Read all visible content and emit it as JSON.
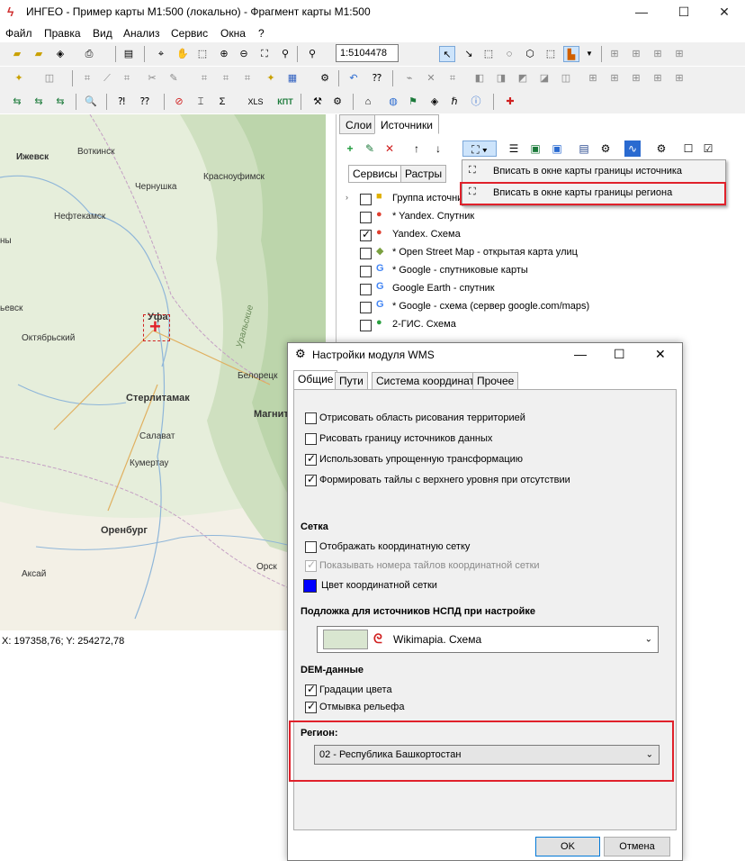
{
  "app": {
    "title": "ИНГЕО - Пример карты М1:500 (локально) - Фрагмент карты М1:500",
    "window_controls": {
      "minimize": "—",
      "maximize": "☐",
      "close": "✕"
    }
  },
  "menu": [
    "Файл",
    "Правка",
    "Вид",
    "Анализ",
    "Сервис",
    "Окна",
    "?"
  ],
  "toolbar": {
    "scale_value": "1:5104478",
    "xls_label": "XLS",
    "kpt_label": "КПТ"
  },
  "map": {
    "cities": [
      {
        "name": "Ижевск",
        "big": false
      },
      {
        "name": "Воткинск",
        "big": false
      },
      {
        "name": "Чернушка",
        "big": false
      },
      {
        "name": "Красноуфимск",
        "big": false
      },
      {
        "name": "Нефтекамск",
        "big": false
      },
      {
        "name": "Уфа",
        "big": true
      },
      {
        "name": "Октябрьский",
        "big": false
      },
      {
        "name": "Стерлитамак",
        "big": true
      },
      {
        "name": "Белорецк",
        "big": false
      },
      {
        "name": "Магнит",
        "big": true
      },
      {
        "name": "Салават",
        "big": false
      },
      {
        "name": "Кумертау",
        "big": false
      },
      {
        "name": "Оренбург",
        "big": true
      },
      {
        "name": "Аксай",
        "big": false
      },
      {
        "name": "Орск",
        "big": false
      },
      {
        "name": "ьевск",
        "big": false
      },
      {
        "name": "ны",
        "big": false
      },
      {
        "name": "Уральские",
        "big": false
      }
    ],
    "coords": "X: 197358,76; Y: 254272,78"
  },
  "panel": {
    "tabs": [
      "Слои",
      "Источники"
    ],
    "subtabs": [
      "Сервисы",
      "Растры"
    ],
    "sources": [
      {
        "label": "Группа источни",
        "checked": false,
        "icon": "folder-icon"
      },
      {
        "label": "* Yandex. Спутник",
        "checked": false,
        "icon": "pin-icon"
      },
      {
        "label": "Yandex. Схема",
        "checked": true,
        "icon": "pin-icon"
      },
      {
        "label": "* Open Street Map - открытая карта улиц",
        "checked": false,
        "icon": "osm-icon"
      },
      {
        "label": "* Google - спутниковые карты",
        "checked": false,
        "icon": "google-icon"
      },
      {
        "label": "Google Earth - спутник",
        "checked": false,
        "icon": "google-icon"
      },
      {
        "label": "* Google - схема (сервер google.com/maps)",
        "checked": false,
        "icon": "google-icon"
      },
      {
        "label": "2-ГИС. Схема",
        "checked": false,
        "icon": "2gis-icon"
      }
    ]
  },
  "popup": {
    "items": [
      "Вписать в окне карты границы источника",
      "Вписать в окне карты границы региона"
    ]
  },
  "dialog": {
    "title": "Настройки модуля WMS",
    "tabs": [
      "Общие",
      "Пути",
      "Система координат",
      "Прочее"
    ],
    "options": [
      {
        "label": "Отрисовать область рисования территорией",
        "checked": false
      },
      {
        "label": "Рисовать границу источников данных",
        "checked": false
      },
      {
        "label": "Использовать упрощенную трансформацию",
        "checked": true
      },
      {
        "label": "Формировать тайлы с верхнего уровня при отсутствии",
        "checked": true
      }
    ],
    "grid_section": "Сетка",
    "grid_options": [
      {
        "label": "Отображать координатную сетку",
        "checked": false,
        "disabled": false
      },
      {
        "label": "Показывать номера тайлов координатной сетки",
        "checked": true,
        "disabled": true
      }
    ],
    "grid_color_label": "Цвет координатной сетки",
    "grid_color": "#0000ff",
    "basemap_section": "Подложка для источников  НСПД  при настройке",
    "basemap_value": "Wikimapia. Схема",
    "dem_section": "DEM-данные",
    "dem_options": [
      {
        "label": "Градации цвета",
        "checked": true
      },
      {
        "label": "Отмывка рельефа",
        "checked": true
      }
    ],
    "region_section": "Регион:",
    "region_value": "02 - Республика Башкортостан",
    "ok": "OK",
    "cancel": "Отмена"
  },
  "colors": {
    "highlight": "#e0212b",
    "accent": "#0078d7"
  }
}
